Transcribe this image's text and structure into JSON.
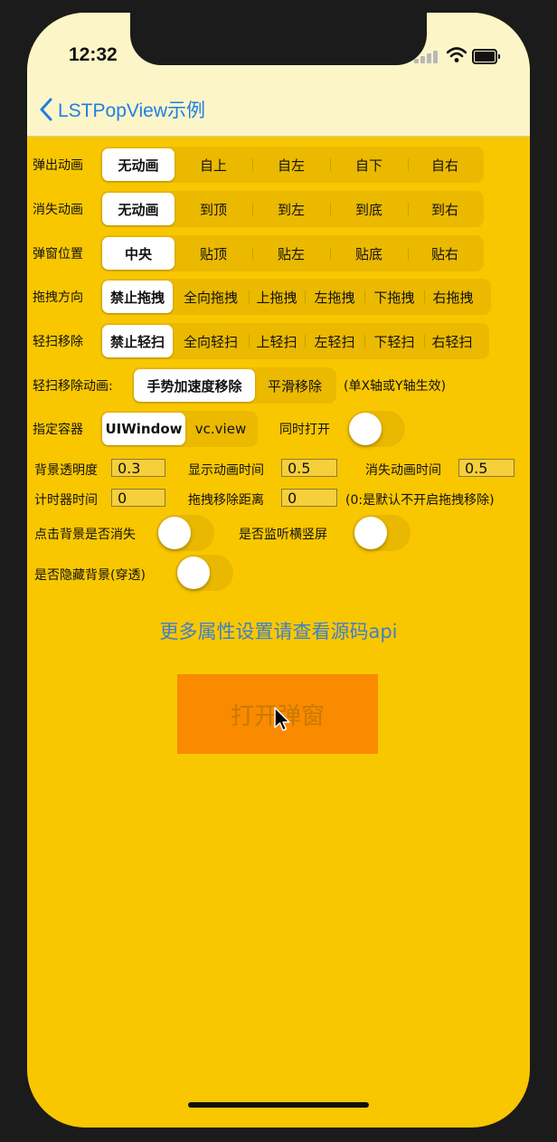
{
  "status": {
    "time": "12:32"
  },
  "nav": {
    "back_label": "LSTPopView示例"
  },
  "rows": {
    "pop_anim": {
      "label": "弹出动画",
      "options": [
        "无动画",
        "自上",
        "自左",
        "自下",
        "自右"
      ]
    },
    "dismiss_anim": {
      "label": "消失动画",
      "options": [
        "无动画",
        "到顶",
        "到左",
        "到底",
        "到右"
      ]
    },
    "position": {
      "label": "弹窗位置",
      "options": [
        "中央",
        "贴顶",
        "贴左",
        "贴底",
        "贴右"
      ]
    },
    "drag_dir": {
      "label": "拖拽方向",
      "options": [
        "禁止拖拽",
        "全向拖拽",
        "上拖拽",
        "左拖拽",
        "下拖拽",
        "右拖拽"
      ]
    },
    "swipe_remove": {
      "label": "轻扫移除",
      "options": [
        "禁止轻扫",
        "全向轻扫",
        "上轻扫",
        "左轻扫",
        "下轻扫",
        "右轻扫"
      ]
    },
    "swipe_anim": {
      "label": "轻扫移除动画:",
      "options": [
        "手势加速度移除",
        "平滑移除"
      ],
      "note": "(单X轴或Y轴生效)"
    },
    "container": {
      "label": "指定容器",
      "options": [
        "UIWindow",
        "vc.view"
      ],
      "toggle_label": "同时打开"
    }
  },
  "fields": {
    "bg_alpha": {
      "label": "背景透明度",
      "value": "0.3"
    },
    "show_time": {
      "label": "显示动画时间",
      "value": "0.5"
    },
    "hide_time": {
      "label": "消失动画时间",
      "value": "0.5"
    },
    "timer": {
      "label": "计时器时间",
      "value": "0"
    },
    "drag_dist": {
      "label": "拖拽移除距离",
      "value": "0",
      "note": "(0:是默认不开启拖拽移除)"
    }
  },
  "toggles": {
    "tap_bg_dismiss": "点击背景是否消失",
    "listen_rotate": "是否监听横竖屏",
    "hide_bg": "是否隐藏背景(穿透)"
  },
  "more_link": "更多属性设置请查看源码api",
  "open_button": "打开弹窗",
  "colors": {
    "background": "#f9c700",
    "nav": "#fbf5c8",
    "accent": "#1f7ee6",
    "open_button": "#fa8a00"
  }
}
